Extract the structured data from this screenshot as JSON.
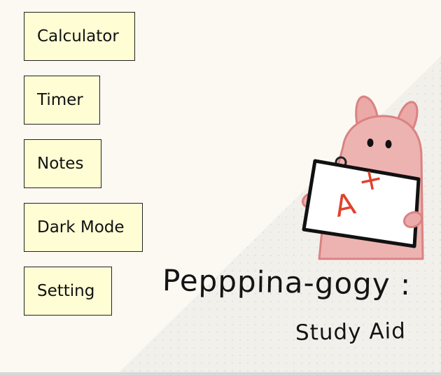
{
  "menu": {
    "items": [
      {
        "label": "Calculator"
      },
      {
        "label": "Timer"
      },
      {
        "label": "Notes"
      },
      {
        "label": "Dark Mode"
      },
      {
        "label": "Setting"
      }
    ]
  },
  "brand": {
    "title": "Pepppina-gogy :",
    "subtitle": "Study Aid",
    "grade": "A",
    "grade_sup": "+"
  },
  "colors": {
    "background": "#fcf9f3",
    "button_fill": "#fefdd4",
    "button_border": "#222222",
    "mascot_pink": "#ebadab",
    "grade_red": "#e0412b"
  }
}
